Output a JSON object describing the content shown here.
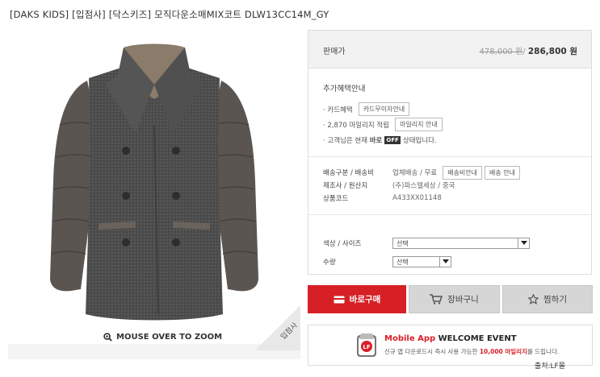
{
  "product_title": "[DAKS KIDS] [입점사] [닥스키즈] 모직다운소매MIX코트 DLW13CC14M_GY",
  "image": {
    "badge": "입점사",
    "zoom_label": "MOUSE OVER TO ZOOM"
  },
  "price": {
    "label": "판매가",
    "original": "478,000 원",
    "separator": "/",
    "sale": "286,800 원"
  },
  "benefits": {
    "title": "추가혜택안내",
    "card_label": "· 카드혜택",
    "card_button": "카드무이자안내",
    "mileage_label": "· 2,870 마일리지 적립",
    "mileage_button": "마일리지 안내",
    "status_prefix": "· 고객님은 현재",
    "status_bold": "바로",
    "status_badge": "OFF",
    "status_suffix": "상태입니다."
  },
  "info": {
    "shipping_label": "배송구분 / 배송비",
    "shipping_value": "업체배송 / 무료",
    "shipping_fee_button": "배송비안내",
    "shipping_button": "배송 안내",
    "maker_label": "제조사 / 원산지",
    "maker_value": "(주)파스텔세상 / 중국",
    "code_label": "상품코드",
    "code_value": "A433XX01148"
  },
  "options": {
    "color_size_label": "색상 / 사이즈",
    "color_size_value": "선택",
    "qty_label": "수량",
    "qty_value": "선택"
  },
  "buttons": {
    "buy": "바로구매",
    "cart": "장바구니",
    "wish": "찜하기"
  },
  "app_banner": {
    "title_red": "Mobile App",
    "title_black": "WELCOME EVENT",
    "sub_prefix": "신규 앱 다운로드시 즉시 사용 가능한",
    "sub_highlight": "10,000 마일리지",
    "sub_suffix": "를 드립니다.",
    "logo_text": "LF"
  },
  "source": "출처:LF몰",
  "colors": {
    "buy_red": "#d71f26",
    "gray_button": "#d6d6d6",
    "coat_body": "#4a4a4a",
    "coat_sleeve": "#5a5450"
  }
}
